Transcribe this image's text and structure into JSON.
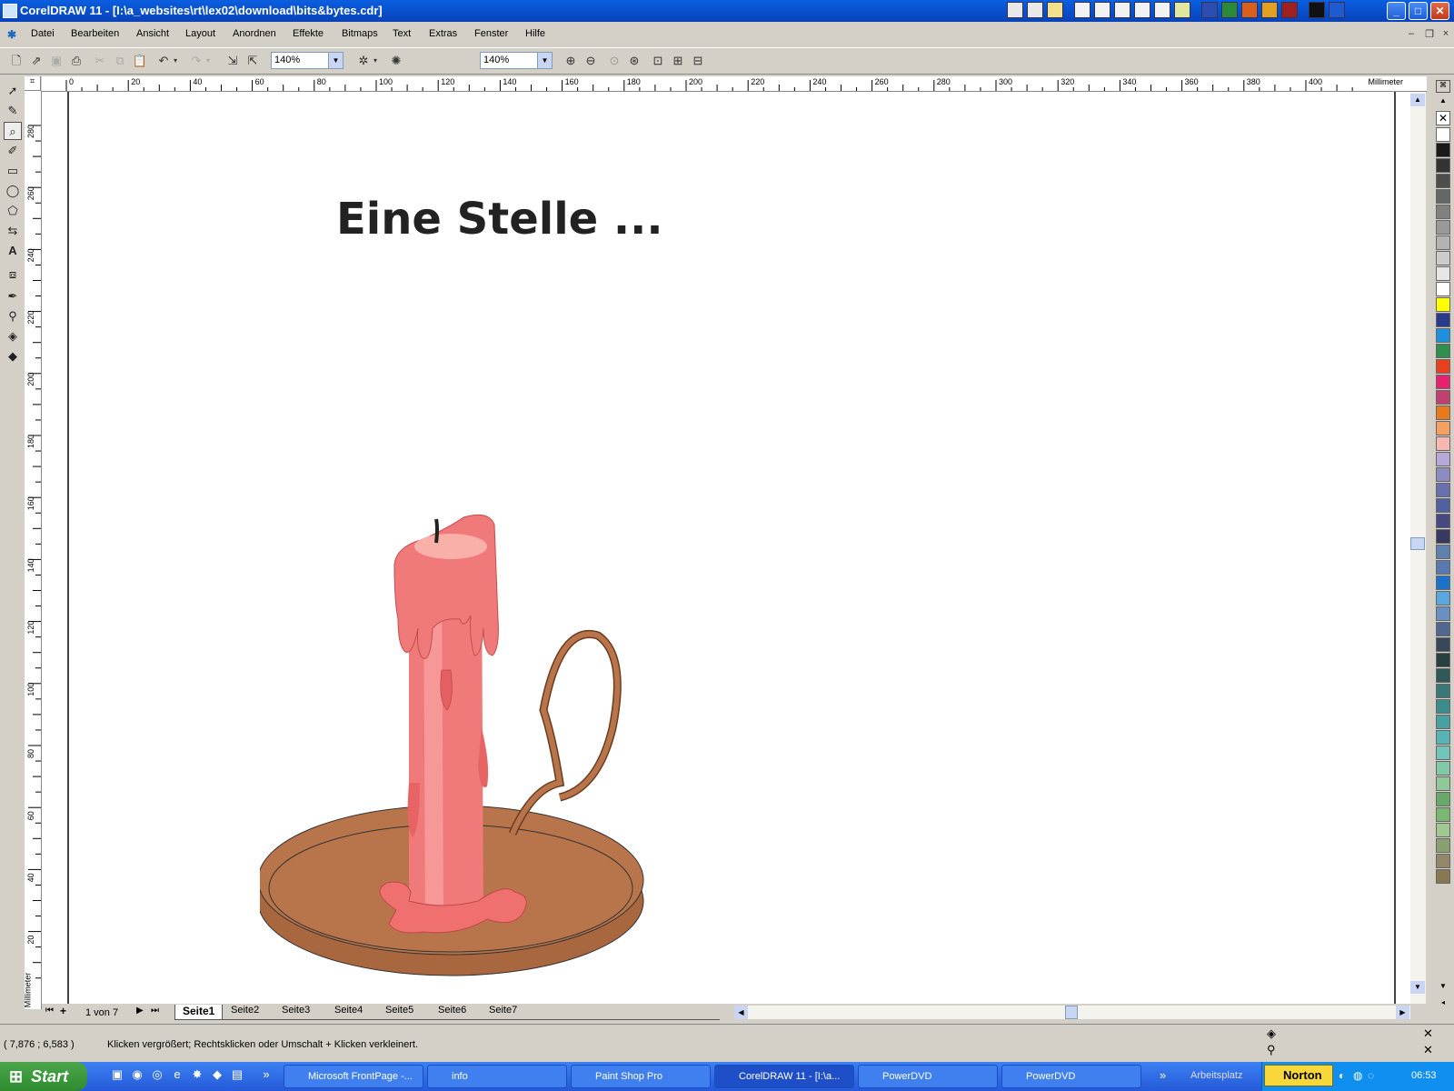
{
  "window": {
    "title": "CorelDRAW 11 - [I:\\a_websites\\rt\\lex02\\download\\bits&bytes.cdr]",
    "minimize": "_",
    "maximize": "□",
    "close": "✕"
  },
  "menu": {
    "items": [
      "Datei",
      "Bearbeiten",
      "Ansicht",
      "Layout",
      "Anordnen",
      "Effekte",
      "Bitmaps",
      "Text",
      "Extras",
      "Fenster",
      "Hilfe"
    ],
    "doc_min": "–",
    "doc_restore": "❐",
    "doc_close": "×"
  },
  "toolbar": {
    "zoom_value": "140%",
    "zoom2_value": "140%"
  },
  "ruler": {
    "unit": "Millimeter",
    "h_ticks": [
      "0",
      "20",
      "40",
      "60",
      "80",
      "100",
      "120",
      "140",
      "160",
      "180",
      "200",
      "220",
      "240",
      "260",
      "280",
      "300",
      "320",
      "340",
      "360",
      "380",
      "400"
    ],
    "v_ticks": [
      "280",
      "260",
      "240",
      "220",
      "200",
      "180",
      "160",
      "140",
      "120",
      "100",
      "80",
      "60",
      "40",
      "20"
    ],
    "v_unit": "Millimeter"
  },
  "canvas": {
    "heading": "Eine Stelle ..."
  },
  "pages": {
    "counter": "1 von 7",
    "tabs": [
      "Seite1",
      "Seite2",
      "Seite3",
      "Seite4",
      "Seite5",
      "Seite6",
      "Seite7"
    ],
    "active": "Seite1"
  },
  "status": {
    "coords": "( 7,876 ; 6,583  )",
    "hint": "Klicken vergrößert; Rechtsklicken oder Umschalt + Klicken verkleinert."
  },
  "taskbar": {
    "start": "Start",
    "tasks": [
      "Microsoft FrontPage -...",
      "info",
      "Paint Shop Pro",
      "CorelDRAW 11 - [I:\\a...",
      "PowerDVD",
      "PowerDVD"
    ],
    "arbeitsplatz": "Arbeitsplatz",
    "norton": "Norton",
    "clock": "06:53"
  },
  "palette_colors": [
    "#ffffff",
    "#1a1a1a",
    "#333333",
    "#4d4d4d",
    "#666666",
    "#808080",
    "#999999",
    "#b3b3b3",
    "#cccccc",
    "#e6e6e6",
    "#ffffff",
    "#ffff00",
    "#2b3a8c",
    "#1e8fdc",
    "#2f8f4f",
    "#e8401c",
    "#e8216f",
    "#c04070",
    "#e87a1c",
    "#f4a060",
    "#f7b8b0",
    "#b8a8d8",
    "#8c8cc0",
    "#6870b0",
    "#5060a0",
    "#484880",
    "#383860",
    "#6080b0",
    "#5878b0",
    "#1c72c8",
    "#58a8e0",
    "#6890c0",
    "#506890",
    "#384858",
    "#284040",
    "#305858",
    "#387878",
    "#3c8c8c",
    "#48a0a0",
    "#58b4b4",
    "#70c4b8",
    "#80c8a8",
    "#90c898",
    "#68a868",
    "#78b870",
    "#a0c890",
    "#88a070",
    "#908868",
    "#887850"
  ]
}
